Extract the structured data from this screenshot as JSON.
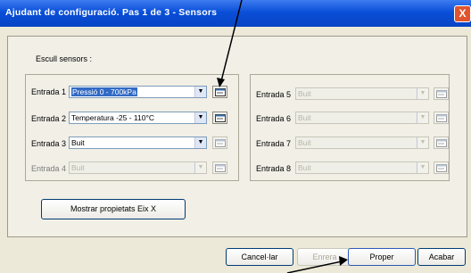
{
  "window": {
    "title": "Ajudant de configuració. Pas 1 de 3 - Sensors",
    "close_glyph": "X"
  },
  "group": {
    "label": "Escull sensors :"
  },
  "left_rows": [
    {
      "label": "Entrada 1",
      "value": "Pressió 0 - 700kPa",
      "enabled": true,
      "selected": true
    },
    {
      "label": "Entrada 2",
      "value": "Temperatura -25 - 110°C",
      "enabled": true,
      "selected": false
    },
    {
      "label": "Entrada 3",
      "value": "Buit",
      "enabled": true,
      "selected": false
    },
    {
      "label": "Entrada 4",
      "value": "Buit",
      "enabled": false,
      "selected": false
    }
  ],
  "right_rows": [
    {
      "label": "Entrada 5",
      "value": "Buit",
      "enabled": false
    },
    {
      "label": "Entrada 6",
      "value": "Buit",
      "enabled": false
    },
    {
      "label": "Entrada 7",
      "value": "Buit",
      "enabled": false
    },
    {
      "label": "Entrada 8",
      "value": "Buit",
      "enabled": false
    }
  ],
  "buttons": {
    "show_axis": "Mostrar propietats Eix X",
    "cancel": "Cancel·lar",
    "back": "Enrera",
    "next": "Proper",
    "finish": "Acabar"
  },
  "annotations": {
    "arrow_color": "#000000"
  }
}
